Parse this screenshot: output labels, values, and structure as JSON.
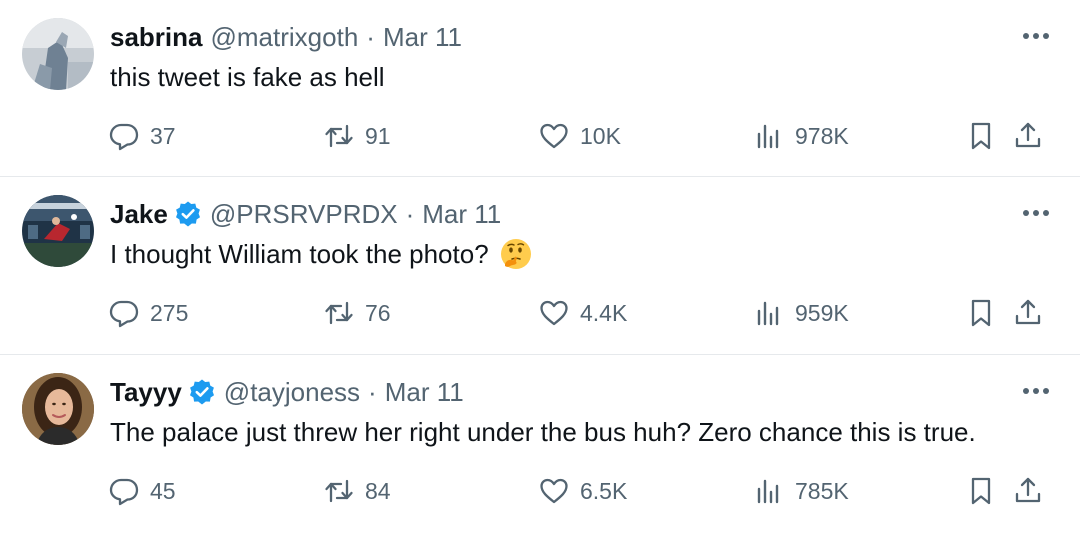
{
  "tweets": [
    {
      "name": "sabrina",
      "handle": "@matrixgoth",
      "separator": "·",
      "date": "Mar 11",
      "verified": false,
      "text": "this tweet is fake as hell",
      "emoji": "",
      "replies": "37",
      "retweets": "91",
      "likes": "10K",
      "views": "978K"
    },
    {
      "name": "Jake",
      "handle": "@PRSRVPRDX",
      "separator": "·",
      "date": "Mar 11",
      "verified": true,
      "text": "I thought William took the photo?",
      "emoji": "thinking-face",
      "replies": "275",
      "retweets": "76",
      "likes": "4.4K",
      "views": "959K"
    },
    {
      "name": "Tayyy",
      "handle": "@tayjoness",
      "separator": "·",
      "date": "Mar 11",
      "verified": true,
      "text": "The palace just threw her right under the bus huh? Zero chance this is true.",
      "emoji": "",
      "replies": "45",
      "retweets": "84",
      "likes": "6.5K",
      "views": "785K"
    }
  ],
  "colors": {
    "text_primary": "#0f1419",
    "text_secondary": "#536471",
    "verified_blue": "#1d9bf0",
    "divider": "#e6e9ec"
  },
  "icons": [
    "reply-icon",
    "retweet-icon",
    "like-icon",
    "views-icon",
    "bookmark-icon",
    "share-icon",
    "more-icon",
    "verified-badge-icon"
  ]
}
